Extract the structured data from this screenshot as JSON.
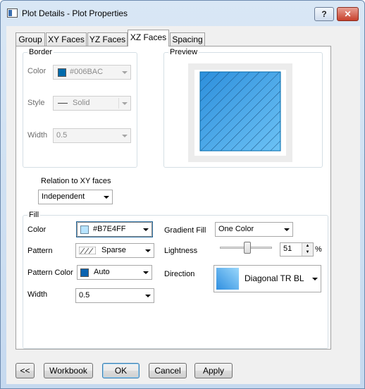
{
  "window": {
    "title": "Plot Details - Plot Properties",
    "help_label": "?",
    "close_label": "✕"
  },
  "tabs": [
    {
      "label": "Group"
    },
    {
      "label": "XY Faces"
    },
    {
      "label": "YZ Faces"
    },
    {
      "label": "XZ Faces",
      "active": true
    },
    {
      "label": "Spacing"
    }
  ],
  "border": {
    "title": "Border",
    "color_label": "Color",
    "color_value": "#006BAC",
    "color_swatch": "#006BAC",
    "style_label": "Style",
    "style_value": "Solid",
    "width_label": "Width",
    "width_value": "0.5"
  },
  "preview": {
    "title": "Preview"
  },
  "relation": {
    "label": "Relation to XY faces",
    "value": "Independent"
  },
  "fill": {
    "title": "Fill",
    "color_label": "Color",
    "color_value": "#B7E4FF",
    "color_swatch": "#B7E4FF",
    "pattern_label": "Pattern",
    "pattern_value": "Sparse",
    "pattern_color_label": "Pattern Color",
    "pattern_color_value": "Auto",
    "pattern_color_swatch": "#0a63b0",
    "width_label": "Width",
    "width_value": "0.5",
    "gradient_label": "Gradient Fill",
    "gradient_value": "One Color",
    "lightness_label": "Lightness",
    "lightness_value": "51",
    "lightness_unit": "%",
    "lightness_level": 0.51,
    "direction_label": "Direction",
    "direction_value": "Diagonal TR BL"
  },
  "buttons": {
    "collapse": "<<",
    "workbook": "Workbook",
    "ok": "OK",
    "cancel": "Cancel",
    "apply": "Apply"
  },
  "colors": {
    "preview_fill": "#4aa8ec",
    "preview_border": "#006BAC",
    "accent": "#3c7fb1"
  },
  "icons": [
    "app-window-icon",
    "help-icon",
    "close-icon",
    "chevron-down-icon",
    "spin-up-icon",
    "spin-down-icon"
  ]
}
